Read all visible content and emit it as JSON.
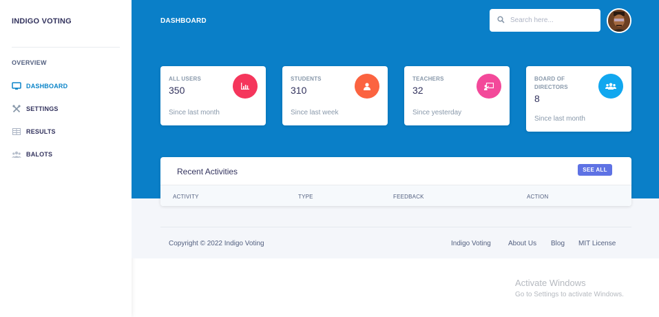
{
  "sidebar": {
    "brand": "INDIGO VOTING",
    "heading": "OVERVIEW",
    "items": [
      {
        "label": "DASHBOARD",
        "icon": "monitor-icon",
        "active": true
      },
      {
        "label": "SETTINGS",
        "icon": "tools-icon",
        "active": false
      },
      {
        "label": "RESULTS",
        "icon": "table-icon",
        "active": false
      },
      {
        "label": "BALOTS",
        "icon": "users-icon",
        "active": false
      }
    ]
  },
  "header": {
    "title": "DASHBOARD",
    "search_placeholder": "Search here..."
  },
  "stats": [
    {
      "title": "ALL USERS",
      "value": "350",
      "since": "Since last month",
      "icon": "bar-chart-icon",
      "color": "#f5365c"
    },
    {
      "title": "STUDENTS",
      "value": "310",
      "since": "Since last week",
      "icon": "user-icon",
      "color": "#fb6340"
    },
    {
      "title": "TEACHERS",
      "value": "32",
      "since": "Since yesterday",
      "icon": "chalkboard-icon",
      "color": "#f3499a"
    },
    {
      "title": "BOARD OF DIRECTORS",
      "value": "8",
      "since": "Since last month",
      "icon": "group-icon",
      "color": "#11a7ef"
    }
  ],
  "activities": {
    "title": "Recent Activities",
    "see_all": "SEE ALL",
    "columns": [
      "ACTIVITY",
      "TYPE",
      "FEEDBACK",
      "ACTION"
    ]
  },
  "footer": {
    "copyright": "Copyright © 2022 Indigo Voting",
    "links": [
      "Indigo Voting",
      "About Us",
      "Blog",
      "MIT License"
    ]
  },
  "watermark": {
    "title": "Activate Windows",
    "subtitle": "Go to Settings to activate Windows."
  },
  "colors": {
    "primary": "#0a7fc8",
    "active_nav": "#0a84c8",
    "button": "#5e72e4"
  }
}
